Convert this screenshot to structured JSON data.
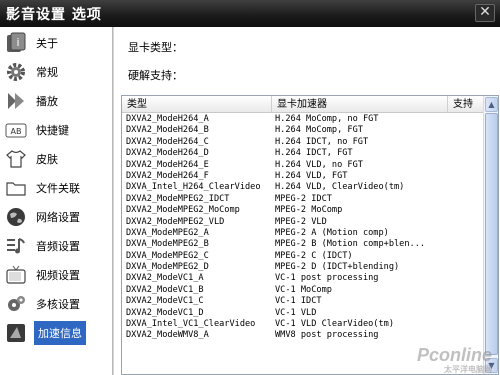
{
  "window": {
    "title": "影音设置 选项",
    "close_symbol": "✕"
  },
  "sidebar": {
    "items": [
      {
        "label": "关于",
        "icon": "about-icon"
      },
      {
        "label": "常规",
        "icon": "gear-icon"
      },
      {
        "label": "播放",
        "icon": "play-icon"
      },
      {
        "label": "快捷键",
        "icon": "keyboard-icon"
      },
      {
        "label": "皮肤",
        "icon": "shirt-icon"
      },
      {
        "label": "文件关联",
        "icon": "folder-icon"
      },
      {
        "label": "网络设置",
        "icon": "globe-icon"
      },
      {
        "label": "音频设置",
        "icon": "audio-icon"
      },
      {
        "label": "视频设置",
        "icon": "tv-icon"
      },
      {
        "label": "多核设置",
        "icon": "multicore-icon"
      },
      {
        "label": "加速信息",
        "icon": "acceleration-icon",
        "active": true
      }
    ]
  },
  "content": {
    "gpu_type_label": "显卡类型：",
    "hw_decode_label": "硬解支持：",
    "table": {
      "columns": [
        "类型",
        "显卡加速器",
        "支持"
      ],
      "rows": [
        [
          "DXVA2_ModeH264_A",
          "H.264 MoComp, no FGT"
        ],
        [
          "DXVA2_ModeH264_B",
          "H.264 MoComp, FGT"
        ],
        [
          "DXVA2_ModeH264_C",
          "H.264 IDCT, no FGT"
        ],
        [
          "DXVA2_ModeH264_D",
          "H.264 IDCT, FGT"
        ],
        [
          "DXVA2_ModeH264_E",
          "H.264 VLD, no FGT"
        ],
        [
          "DXVA2_ModeH264_F",
          "H.264 VLD, FGT"
        ],
        [
          "DXVA_Intel_H264_ClearVideo",
          "H.264 VLD, ClearVideo(tm)"
        ],
        [
          "DXVA2_ModeMPEG2_IDCT",
          "MPEG-2 IDCT"
        ],
        [
          "DXVA2_ModeMPEG2_MoComp",
          "MPEG-2 MoComp"
        ],
        [
          "DXVA2_ModeMPEG2_VLD",
          "MPEG-2 VLD"
        ],
        [
          "DXVA_ModeMPEG2_A",
          "MPEG-2 A (Motion comp)"
        ],
        [
          "DXVA_ModeMPEG2_B",
          "MPEG-2 B (Motion comp+blen..."
        ],
        [
          "DXVA_ModeMPEG2_C",
          "MPEG-2 C (IDCT)"
        ],
        [
          "DXVA_ModeMPEG2_D",
          "MPEG-2 D (IDCT+blending)"
        ],
        [
          "DXVA2_ModeVC1_A",
          "VC-1 post processing"
        ],
        [
          "DXVA2_ModeVC1_B",
          "VC-1 MoComp"
        ],
        [
          "DXVA2_ModeVC1_C",
          "VC-1 IDCT"
        ],
        [
          "DXVA2_ModeVC1_D",
          "VC-1 VLD"
        ],
        [
          "DXVA_Intel_VC1_ClearVideo",
          "VC-1 VLD ClearVideo(tm)"
        ],
        [
          "DXVA2_ModeWMV8_A",
          "WMV8 post processing"
        ]
      ]
    }
  },
  "watermark": {
    "text": "Pconline",
    "sub": "太平洋电脑网"
  },
  "colors": {
    "titlebar": "#1a1a1a",
    "active_item": "#2f68c2"
  }
}
